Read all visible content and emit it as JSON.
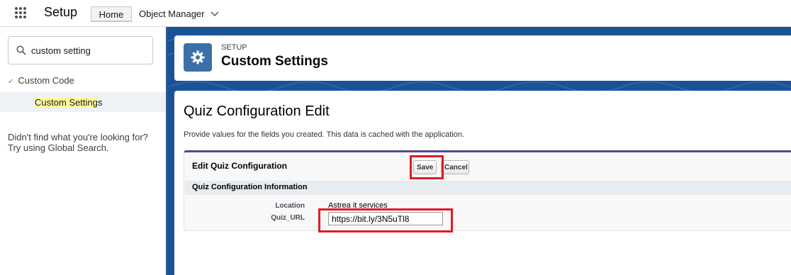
{
  "topbar": {
    "app_name": "Setup",
    "tabs": [
      {
        "label": "Home"
      },
      {
        "label": "Object Manager"
      }
    ]
  },
  "sidebar": {
    "search": {
      "value": "custom setting"
    },
    "tree": {
      "parent_label": "Custom Code",
      "child_label_highlight": "Custom Setting",
      "child_label_rest": "s"
    },
    "not_found_line1": "Didn't find what you're looking for?",
    "not_found_line2": "Try using Global Search."
  },
  "header": {
    "eyebrow": "SETUP",
    "title": "Custom Settings",
    "icon": "gear-icon",
    "icon_bg": "#3c6fa8"
  },
  "content": {
    "title": "Quiz Configuration Edit",
    "description": "Provide values for the fields you created. This data is cached with the application.",
    "edit_block": {
      "title": "Edit Quiz Configuration",
      "save_label": "Save",
      "cancel_label": "Cancel",
      "section_title": "Quiz Configuration Information",
      "fields": {
        "location": {
          "label": "Location",
          "value": "Astrea it services"
        },
        "quiz_url": {
          "label": "Quiz_URL",
          "value": "https://bit.ly/3N5uTl8"
        }
      }
    }
  },
  "colors": {
    "background_blue": "#1b5297",
    "highlight_red": "#e31b23",
    "edit_block_accent": "#56458c",
    "search_highlight": "#ffff9e"
  }
}
